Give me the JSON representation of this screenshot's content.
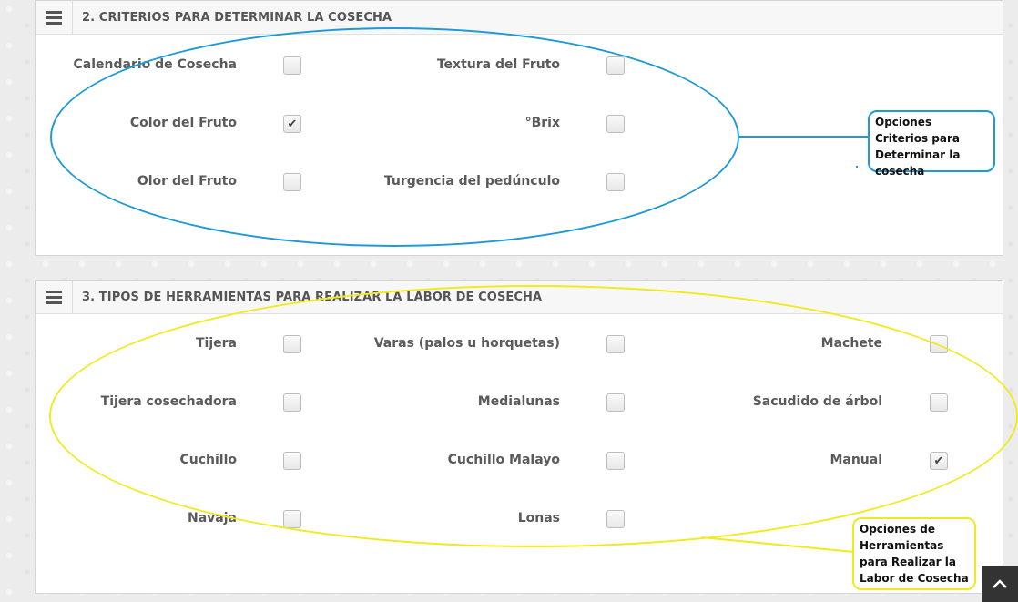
{
  "section2": {
    "title": "2. CRITERIOS PARA DETERMINAR LA COSECHA",
    "options": [
      {
        "label": "Calendario de Cosecha",
        "checked": false
      },
      {
        "label": "Textura del Fruto",
        "checked": false
      },
      {
        "label": "Color del Fruto",
        "checked": true
      },
      {
        "label": "°Brix",
        "checked": false
      },
      {
        "label": "Olor del Fruto",
        "checked": false
      },
      {
        "label": "Turgencia del pedúnculo",
        "checked": false
      }
    ]
  },
  "section3": {
    "title": "3. TIPOS DE HERRAMIENTAS PARA REALIZAR LA LABOR DE COSECHA",
    "options": [
      {
        "label": "Tijera",
        "checked": false
      },
      {
        "label": "Varas (palos u horquetas)",
        "checked": false
      },
      {
        "label": "Machete",
        "checked": false
      },
      {
        "label": "Tijera cosechadora",
        "checked": false
      },
      {
        "label": "Medialunas",
        "checked": false
      },
      {
        "label": "Sacudido de árbol",
        "checked": false
      },
      {
        "label": "Cuchillo",
        "checked": false
      },
      {
        "label": "Cuchillo Malayo",
        "checked": false
      },
      {
        "label": "Manual",
        "checked": true
      },
      {
        "label": "Navaja",
        "checked": false
      },
      {
        "label": "Lonas",
        "checked": false
      }
    ]
  },
  "annotations": {
    "criterios_note": "Opciones Criterios para Determinar la cosecha",
    "herramientas_note": "Opciones de Herramientas para Realizar la Labor de Cosecha",
    "blue": "#1e9ad6",
    "yellow": "#f2ea1c"
  },
  "icons": {
    "check": "✔",
    "menu": "hamburger-icon",
    "scroll_top": "chevron-up-icon"
  }
}
